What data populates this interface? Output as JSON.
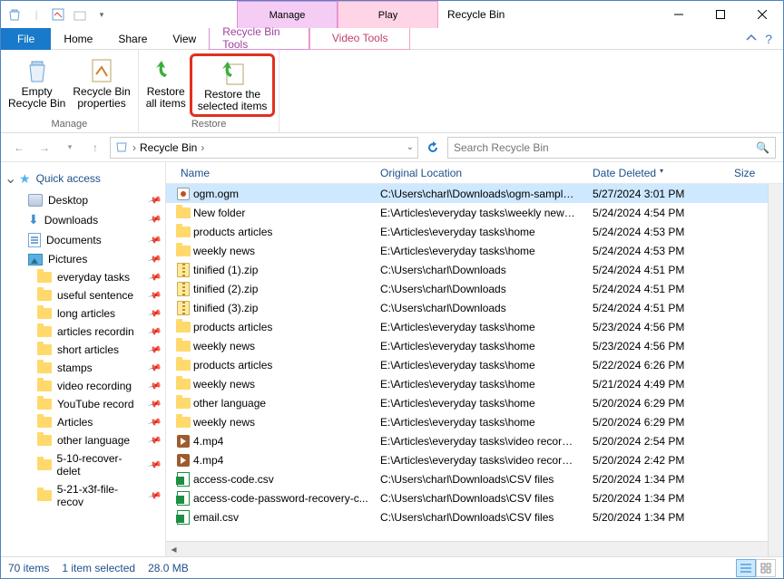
{
  "window": {
    "title": "Recycle Bin"
  },
  "context_tabs": {
    "manage": "Manage",
    "play": "Play"
  },
  "ribbon_tabs": {
    "file": "File",
    "home": "Home",
    "share": "Share",
    "view": "View",
    "recycle_tools": "Recycle Bin Tools",
    "video_tools": "Video Tools"
  },
  "ribbon": {
    "empty_bin": "Empty\nRecycle Bin",
    "bin_props": "Recycle Bin\nproperties",
    "restore_all": "Restore\nall items",
    "restore_sel": "Restore the\nselected items",
    "group_manage": "Manage",
    "group_restore": "Restore"
  },
  "breadcrumb": {
    "root": "Recycle Bin"
  },
  "search": {
    "placeholder": "Search Recycle Bin"
  },
  "sidebar": {
    "quick_access": "Quick access",
    "items": [
      {
        "label": "Desktop",
        "icon": "disk"
      },
      {
        "label": "Downloads",
        "icon": "dl"
      },
      {
        "label": "Documents",
        "icon": "doc"
      },
      {
        "label": "Pictures",
        "icon": "pic"
      },
      {
        "label": "everyday tasks",
        "icon": "folder",
        "lvl": 2
      },
      {
        "label": "useful sentence",
        "icon": "folder",
        "lvl": 2
      },
      {
        "label": "long articles",
        "icon": "folder",
        "lvl": 2
      },
      {
        "label": "articles recordin",
        "icon": "folder",
        "lvl": 2
      },
      {
        "label": "short articles",
        "icon": "folder",
        "lvl": 2
      },
      {
        "label": "stamps",
        "icon": "folder",
        "lvl": 2
      },
      {
        "label": "video recording",
        "icon": "folder",
        "lvl": 2
      },
      {
        "label": "YouTube record",
        "icon": "folder",
        "lvl": 2
      },
      {
        "label": "Articles",
        "icon": "folder",
        "lvl": 2
      },
      {
        "label": "other language",
        "icon": "folder",
        "lvl": 2
      },
      {
        "label": "5-10-recover-delet",
        "icon": "folder",
        "lvl": 2
      },
      {
        "label": "5-21-x3f-file-recov",
        "icon": "folder",
        "lvl": 2
      }
    ]
  },
  "columns": {
    "name": "Name",
    "loc": "Original Location",
    "date": "Date Deleted",
    "size": "Size"
  },
  "rows": [
    {
      "icon": "ogm",
      "name": "ogm.ogm",
      "loc": "C:\\Users\\charl\\Downloads\\ogm-sample-...",
      "date": "5/27/2024 3:01 PM",
      "sel": true
    },
    {
      "icon": "folder",
      "name": "New folder",
      "loc": "E:\\Articles\\everyday tasks\\weekly news\\0...",
      "date": "5/24/2024 4:54 PM"
    },
    {
      "icon": "folder",
      "name": "products articles",
      "loc": "E:\\Articles\\everyday tasks\\home",
      "date": "5/24/2024 4:53 PM"
    },
    {
      "icon": "folder",
      "name": "weekly news",
      "loc": "E:\\Articles\\everyday tasks\\home",
      "date": "5/24/2024 4:53 PM"
    },
    {
      "icon": "zip",
      "name": "tinified (1).zip",
      "loc": "C:\\Users\\charl\\Downloads",
      "date": "5/24/2024 4:51 PM"
    },
    {
      "icon": "zip",
      "name": "tinified (2).zip",
      "loc": "C:\\Users\\charl\\Downloads",
      "date": "5/24/2024 4:51 PM"
    },
    {
      "icon": "zip",
      "name": "tinified (3).zip",
      "loc": "C:\\Users\\charl\\Downloads",
      "date": "5/24/2024 4:51 PM"
    },
    {
      "icon": "folder",
      "name": "products articles",
      "loc": "E:\\Articles\\everyday tasks\\home",
      "date": "5/23/2024 4:56 PM"
    },
    {
      "icon": "folder",
      "name": "weekly news",
      "loc": "E:\\Articles\\everyday tasks\\home",
      "date": "5/23/2024 4:56 PM"
    },
    {
      "icon": "folder",
      "name": "products articles",
      "loc": "E:\\Articles\\everyday tasks\\home",
      "date": "5/22/2024 6:26 PM"
    },
    {
      "icon": "folder",
      "name": "weekly news",
      "loc": "E:\\Articles\\everyday tasks\\home",
      "date": "5/21/2024 4:49 PM"
    },
    {
      "icon": "folder",
      "name": "other language",
      "loc": "E:\\Articles\\everyday tasks\\home",
      "date": "5/20/2024 6:29 PM"
    },
    {
      "icon": "folder",
      "name": "weekly news",
      "loc": "E:\\Articles\\everyday tasks\\home",
      "date": "5/20/2024 6:29 PM"
    },
    {
      "icon": "vid",
      "name": "4.mp4",
      "loc": "E:\\Articles\\everyday tasks\\video recordin...",
      "date": "5/20/2024 2:54 PM"
    },
    {
      "icon": "vid",
      "name": "4.mp4",
      "loc": "E:\\Articles\\everyday tasks\\video recordin...",
      "date": "5/20/2024 2:42 PM"
    },
    {
      "icon": "csv",
      "name": "access-code.csv",
      "loc": "C:\\Users\\charl\\Downloads\\CSV files",
      "date": "5/20/2024 1:34 PM"
    },
    {
      "icon": "csv",
      "name": "access-code-password-recovery-c...",
      "loc": "C:\\Users\\charl\\Downloads\\CSV files",
      "date": "5/20/2024 1:34 PM"
    },
    {
      "icon": "csv",
      "name": "email.csv",
      "loc": "C:\\Users\\charl\\Downloads\\CSV files",
      "date": "5/20/2024 1:34 PM"
    }
  ],
  "status": {
    "count": "70 items",
    "selected": "1 item selected",
    "size": "28.0 MB"
  }
}
